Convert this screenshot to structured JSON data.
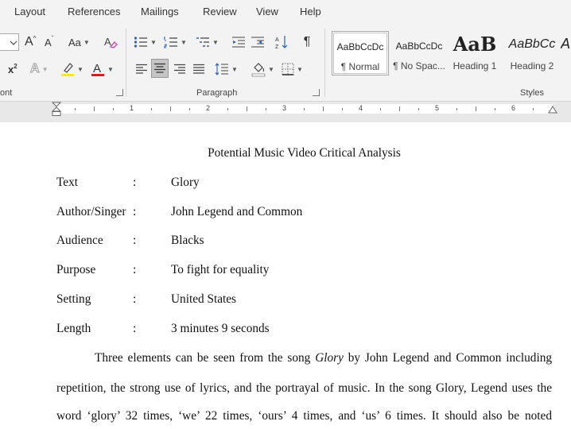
{
  "ribbon_tabs": [
    "Layout",
    "References",
    "Mailings",
    "Review",
    "View",
    "Help"
  ],
  "font_group": {
    "grow_label": "A",
    "shrink_label": "A",
    "change_case_label": "Aa",
    "superscript_label": "x",
    "superscript_exp": "2",
    "label": "ont",
    "highlight_color": "#ffeb00",
    "font_color": "#d41e1e"
  },
  "paragraph_group": {
    "label": "Paragraph",
    "show_marks_label": "¶"
  },
  "styles_group": {
    "label": "Styles",
    "items": [
      {
        "preview": "AaBbCcDc",
        "name": "¶ Normal",
        "selected": true
      },
      {
        "preview": "AaBbCcDc",
        "name": "¶ No Spac...",
        "selected": false
      },
      {
        "preview": "AaB",
        "name": "Heading 1",
        "selected": false
      },
      {
        "preview": "AaBbCc",
        "name": "Heading 2",
        "selected": false
      },
      {
        "preview": "A",
        "name": "",
        "selected": false
      }
    ]
  },
  "ruler": {
    "numbers": [
      "1",
      "2",
      "3",
      "4",
      "5",
      "6"
    ]
  },
  "document": {
    "title": "Potential Music Video Critical Analysis",
    "rows": [
      {
        "label": "Text",
        "colon": ":",
        "value": "Glory"
      },
      {
        "label": "Author/Singer",
        "colon": ":",
        "value": "John Legend and Common"
      },
      {
        "label": "Audience",
        "colon": ":",
        "value": "Blacks"
      },
      {
        "label": "Purpose",
        "colon": ":",
        "value": "To fight for equality"
      },
      {
        "label": "Setting",
        "colon": ":",
        "value": "United States"
      },
      {
        "label": "Length",
        "colon": ":",
        "value": "3 minutes 9 seconds"
      }
    ],
    "paragraph": {
      "line1_before": "Three elements can be seen from the song ",
      "line1_italic": "Glory",
      "line1_after": " by John Legend and Common including",
      "line2": "repetition, the strong use of lyrics, and the portrayal of music. In the song Glory, Legend uses the",
      "line3": "word ‘glory’ 32 times, ‘we’ 22 times, ‘ours’ 4 times, and ‘us’ 6 times. It should also be noted"
    }
  }
}
